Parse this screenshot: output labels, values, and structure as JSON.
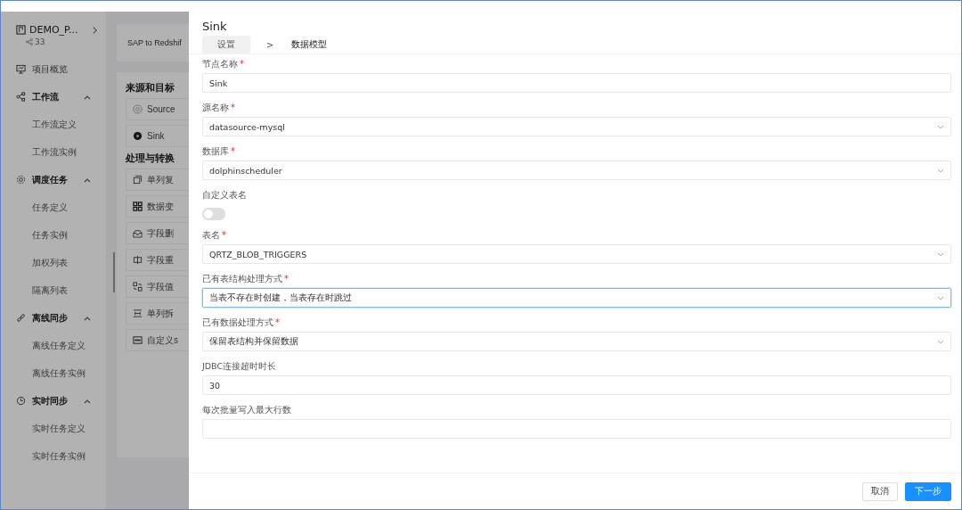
{
  "sidebar": {
    "project": {
      "name": "DEMO_P...",
      "count": "33"
    },
    "items": [
      {
        "kind": "link",
        "label": "项目概览"
      },
      {
        "kind": "group",
        "label": "工作流",
        "expanded": true,
        "children": [
          {
            "label": "工作流定义"
          },
          {
            "label": "工作流实例"
          }
        ]
      },
      {
        "kind": "group",
        "label": "调度任务",
        "expanded": true,
        "children": [
          {
            "label": "任务定义"
          },
          {
            "label": "任务实例"
          },
          {
            "label": "加权列表"
          },
          {
            "label": "隔离列表"
          }
        ]
      },
      {
        "kind": "group",
        "label": "离线同步",
        "expanded": true,
        "children": [
          {
            "label": "离线任务定义"
          },
          {
            "label": "离线任务实例"
          }
        ]
      },
      {
        "kind": "group",
        "label": "实时同步",
        "expanded": true,
        "children": [
          {
            "label": "实时任务定义"
          },
          {
            "label": "实时任务实例"
          }
        ]
      }
    ]
  },
  "canvas": {
    "title": "SAP to Redshif",
    "sections": [
      {
        "title": "来源和目标",
        "nodes": [
          {
            "label": "Source"
          },
          {
            "label": "Sink"
          }
        ]
      },
      {
        "title": "处理与转换",
        "nodes": [
          {
            "label": "单列复"
          },
          {
            "label": "数据变"
          },
          {
            "label": "字段删"
          },
          {
            "label": "字段重"
          },
          {
            "label": "字段值"
          },
          {
            "label": "单列拆"
          },
          {
            "label": "自定义s"
          }
        ]
      }
    ]
  },
  "drawer": {
    "title": "Sink",
    "steps": [
      {
        "label": "设置",
        "selected": true
      },
      {
        "label": "数据模型",
        "selected": false
      }
    ],
    "step_separator": ">",
    "required_mark": "*",
    "fields": [
      {
        "kind": "text",
        "label": "节点名称",
        "required": true,
        "value": "Sink",
        "focused": false
      },
      {
        "kind": "select",
        "label": "源名称",
        "required": true,
        "value": "datasource-mysql",
        "focused": false
      },
      {
        "kind": "select",
        "label": "数据库",
        "required": true,
        "value": "dolphinscheduler",
        "focused": false
      },
      {
        "kind": "switch",
        "label": "自定义表名",
        "required": false,
        "on": false
      },
      {
        "kind": "select",
        "label": "表名",
        "required": true,
        "value": "QRTZ_BLOB_TRIGGERS",
        "focused": false
      },
      {
        "kind": "select",
        "label": "已有表结构处理方式",
        "required": true,
        "value": "当表不存在时创建，当表存在时跳过",
        "focused": true
      },
      {
        "kind": "select",
        "label": "已有数据处理方式",
        "required": true,
        "value": "保留表结构并保留数据",
        "focused": false
      },
      {
        "kind": "text",
        "label": "JDBC连接超时时长",
        "required": false,
        "value": "30",
        "focused": false
      },
      {
        "kind": "text",
        "label": "每次批量写入最大行数",
        "required": false,
        "focused": false
      }
    ],
    "buttons": [
      {
        "label": "取消",
        "kind": "secondary"
      },
      {
        "label": "下一步",
        "kind": "primary"
      }
    ]
  }
}
